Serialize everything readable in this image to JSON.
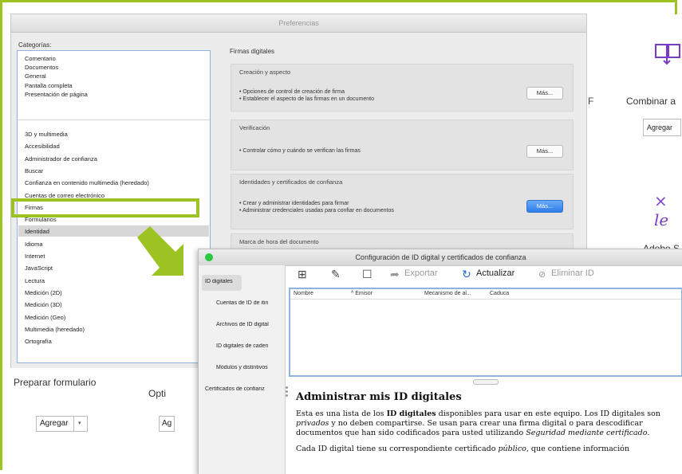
{
  "preferences": {
    "title": "Preferencias",
    "categories_label": "Categorías:",
    "categories_group1": [
      "Comentario",
      "Documentos",
      "General",
      "Pantalla completa",
      "Presentación de página"
    ],
    "categories_group2": [
      "3D y multimedia",
      "Accesibilidad",
      "Administrador de confianza",
      "Buscar",
      "Confianza en contenido multimedia (heredado)",
      "Cuentas de correo electrónico",
      "Firmas",
      "Formularios",
      "Identidad",
      "Idioma",
      "Internet",
      "JavaScript",
      "Lectura",
      "Medición (2D)",
      "Medición (3D)",
      "Medición (Geo)",
      "Multimedia (heredado)",
      "Ortografía"
    ],
    "selected_category": "Firmas",
    "signatures_heading": "Firmas digitales",
    "sections": [
      {
        "title": "Creación y aspecto",
        "lines": [
          "• Opciones de control de creación de firma",
          "• Establecer el aspecto de las firmas en un documento"
        ],
        "button": "Más..."
      },
      {
        "title": "Verificación",
        "lines": [
          "• Controlar cómo y cuándo se verifican las firmas"
        ],
        "button": "Más..."
      },
      {
        "title": "Identidades y certificados de confianza",
        "lines": [
          "• Crear y administrar identidades para firmar",
          "• Administrar credenciales usadas para confiar en documentos"
        ],
        "button": "Más..."
      },
      {
        "title": "Marca de hora del documento",
        "lines": [],
        "button": ""
      }
    ]
  },
  "background": {
    "f_letter": "F",
    "combine_label": "Combinar a",
    "agregar_right": "Agregar",
    "adobe_label": "Adobe S",
    "sign_glyph": "× le",
    "prepare_label": "Preparar formulario",
    "opti_label": "Opti",
    "agregar_bottom": "Agregar",
    "ag_bottom": "Ag"
  },
  "id_window": {
    "title": "Configuración de ID digital y certificados de confianza",
    "sidebar": [
      "ID digitales",
      "Cuentas de ID de itin",
      "Archivos de ID digital",
      "ID digitales de caden",
      "Módulos y distintivos",
      "Certificados de confianz"
    ],
    "toolbar": {
      "exportar": "Exportar",
      "actualizar": "Actualizar",
      "eliminar": "Eliminar ID"
    },
    "columns": [
      "Nombre",
      "^ Emisor",
      "Mecanismo de al...",
      "Caduca"
    ],
    "heading": "Administrar mis ID digitales",
    "p1_a": "Esta es una lista de los ",
    "p1_b": "ID digitales",
    "p1_c": " disponibles para usar en este equipo. Los ID digitales son ",
    "p1_d": "privados",
    "p1_e": " y no deben compartirse. Se usan para crear una firma digital o para descodificar documentos que han sido codificados para usted utilizando ",
    "p1_f": "Seguridad mediante certificado",
    "p1_g": ".",
    "p2_a": "Cada ID digital tiene su correspondiente certificado ",
    "p2_b": "público",
    "p2_c": ", que contiene información"
  },
  "colors": {
    "accent": "#9cc321",
    "selected_blue": "#2e7de9",
    "purple": "#7c3bc6",
    "green_dot": "#28c840"
  }
}
